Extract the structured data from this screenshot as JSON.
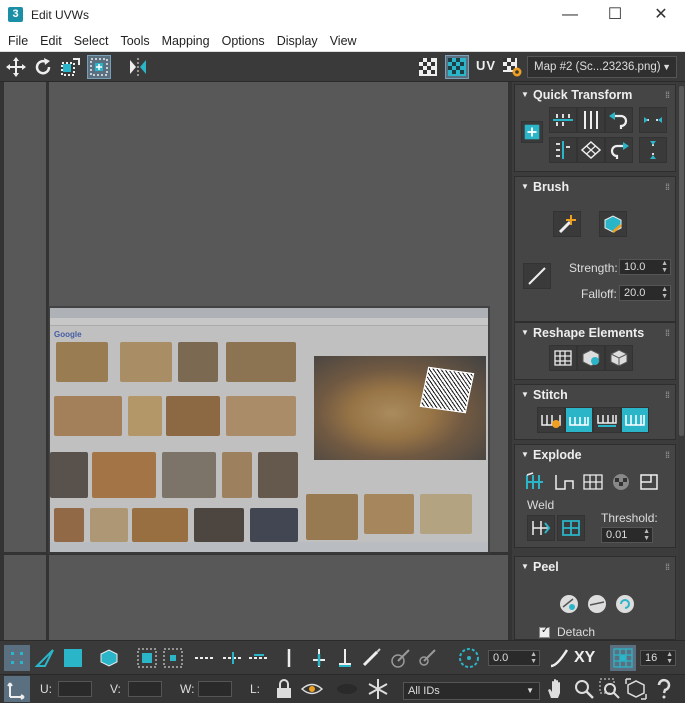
{
  "window": {
    "app_icon": "3",
    "title": "Edit UVWs",
    "minimize": "—",
    "maximize": "☐",
    "close": "✕"
  },
  "menu": [
    "File",
    "Edit",
    "Select",
    "Tools",
    "Mapping",
    "Options",
    "Display",
    "View"
  ],
  "toolbar": {
    "uv_label": "UV",
    "map_select": "Map #2 (Sc...23236.png)"
  },
  "panel": {
    "quick_transform": "Quick Transform",
    "brush": "Brush",
    "strength_label": "Strength:",
    "strength_value": "10.0",
    "falloff_label": "Falloff:",
    "falloff_value": "20.0",
    "reshape": "Reshape Elements",
    "stitch": "Stitch",
    "explode": "Explode",
    "weld": "Weld",
    "threshold_label": "Threshold:",
    "threshold_value": "0.01",
    "peel": "Peel",
    "detach": "Detach"
  },
  "bottom": {
    "angle_value": "0.0",
    "xy_label": "XY",
    "count_value": "16",
    "u_label": "U:",
    "v_label": "V:",
    "w_label": "W:",
    "l_label": "L:",
    "ids_select": "All IDs"
  },
  "colors": {
    "accent": "#2bb5c8",
    "panel_bg": "#454545",
    "viewport_bg": "#585858"
  }
}
